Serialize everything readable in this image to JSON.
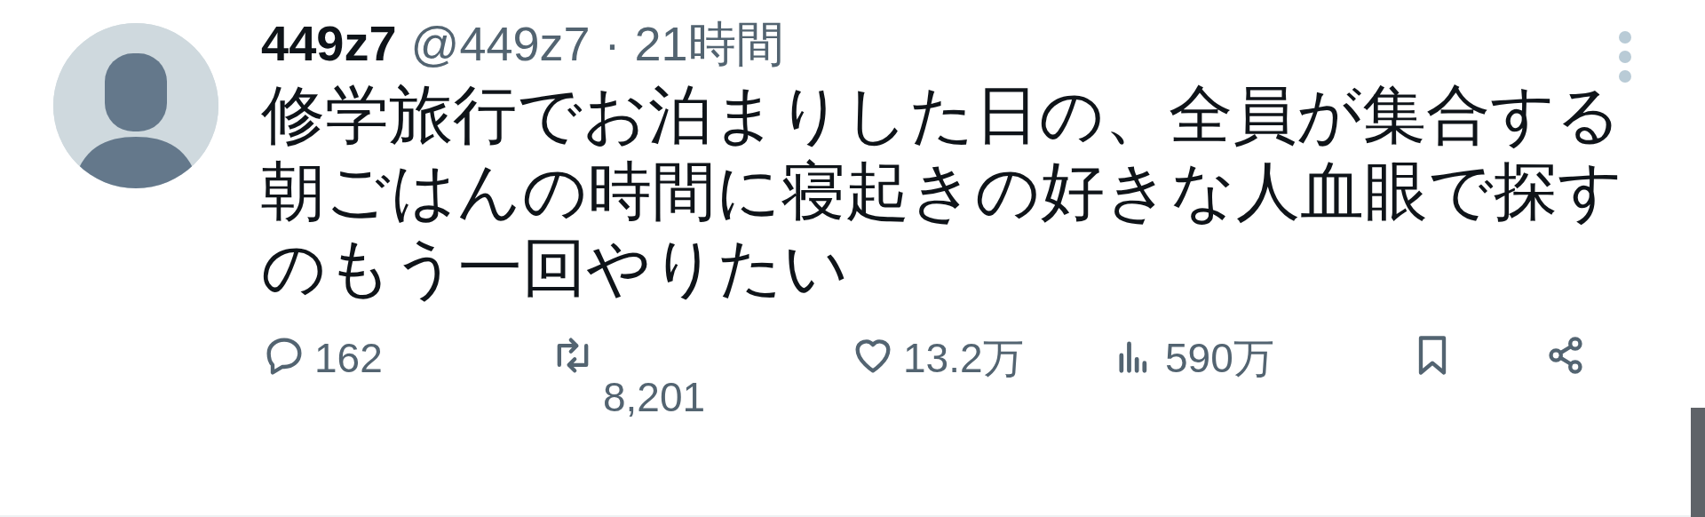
{
  "post": {
    "display_name": "449z7",
    "handle": "@449z7",
    "separator": "·",
    "time": "21時間",
    "text": "修学旅行でお泊まりした日の、全員が集合する朝ごはんの時間に寝起きの好きな人血眼で探すのもう一回やりたい",
    "actions": [
      {
        "kind": "reply",
        "count": "162"
      },
      {
        "kind": "repost",
        "count": "8,201"
      },
      {
        "kind": "like",
        "count": "13.2万"
      },
      {
        "kind": "views",
        "count": "590万"
      },
      {
        "kind": "bookmark"
      },
      {
        "kind": "share"
      }
    ]
  }
}
